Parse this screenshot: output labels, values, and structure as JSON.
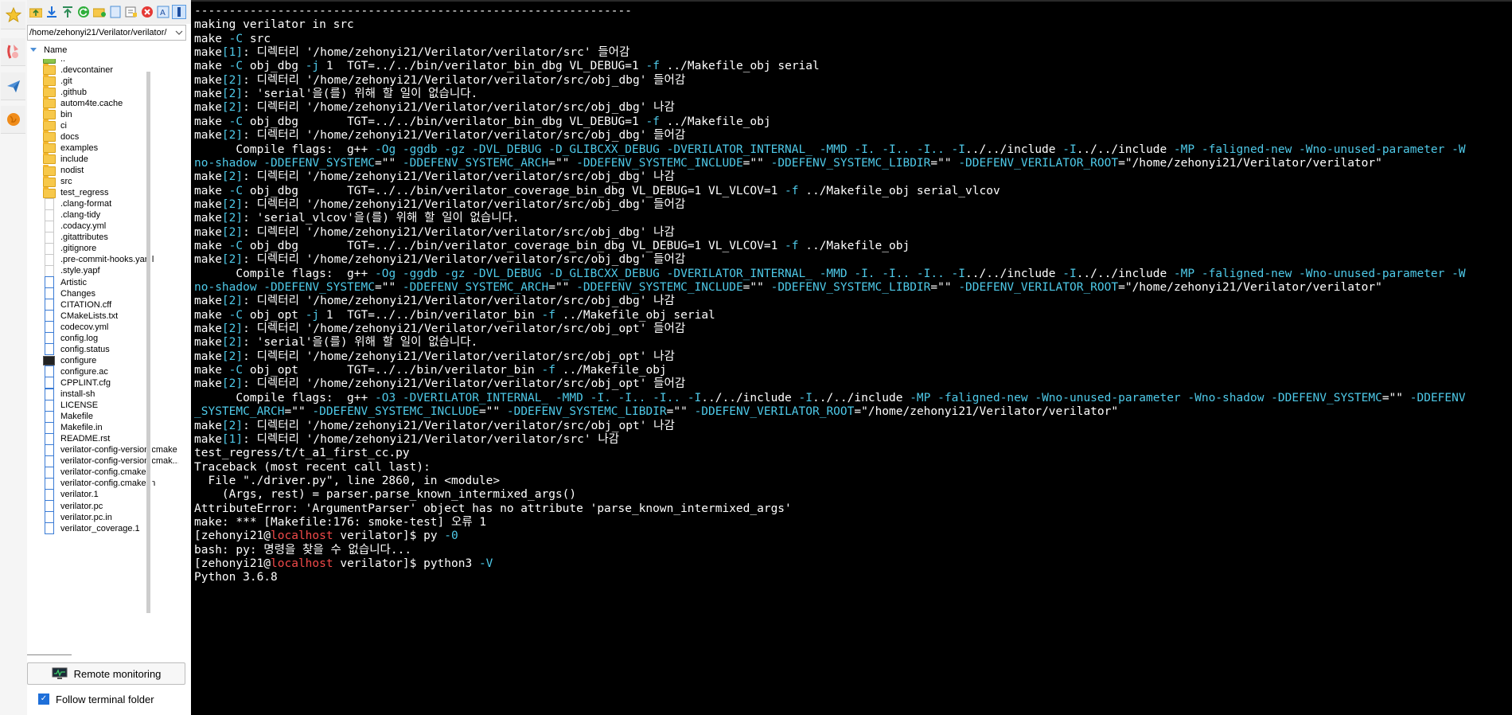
{
  "sidebar_strip": {
    "icons": [
      "star-icon",
      "sftp-icon",
      "send-icon",
      "globe-icon"
    ]
  },
  "file_browser": {
    "toolbar_icons": [
      "up-folder-icon",
      "download-icon",
      "upload-icon",
      "refresh-icon",
      "new-folder-icon",
      "new-file-icon",
      "delete-icon",
      "rename-icon",
      "properties-icon"
    ],
    "path": "/home/zehonyi21/Verilator/verilator/",
    "column_name": "Name",
    "items": [
      {
        "name": "..",
        "type": "up"
      },
      {
        "name": ".devcontainer",
        "type": "folder"
      },
      {
        "name": ".git",
        "type": "folder"
      },
      {
        "name": ".github",
        "type": "folder"
      },
      {
        "name": "autom4te.cache",
        "type": "folder"
      },
      {
        "name": "bin",
        "type": "folder"
      },
      {
        "name": "ci",
        "type": "folder"
      },
      {
        "name": "docs",
        "type": "folder"
      },
      {
        "name": "examples",
        "type": "folder"
      },
      {
        "name": "include",
        "type": "folder"
      },
      {
        "name": "nodist",
        "type": "folder"
      },
      {
        "name": "src",
        "type": "folder"
      },
      {
        "name": "test_regress",
        "type": "folder"
      },
      {
        "name": ".clang-format",
        "type": "blank"
      },
      {
        "name": ".clang-tidy",
        "type": "blank"
      },
      {
        "name": ".codacy.yml",
        "type": "blank"
      },
      {
        "name": ".gitattributes",
        "type": "blank"
      },
      {
        "name": ".gitignore",
        "type": "blank"
      },
      {
        "name": ".pre-commit-hooks.yaml",
        "type": "blank"
      },
      {
        "name": ".style.yapf",
        "type": "blank"
      },
      {
        "name": "Artistic",
        "type": "file"
      },
      {
        "name": "Changes",
        "type": "file"
      },
      {
        "name": "CITATION.cff",
        "type": "file"
      },
      {
        "name": "CMakeLists.txt",
        "type": "file"
      },
      {
        "name": "codecov.yml",
        "type": "file"
      },
      {
        "name": "config.log",
        "type": "file"
      },
      {
        "name": "config.status",
        "type": "file"
      },
      {
        "name": "configure",
        "type": "exe"
      },
      {
        "name": "configure.ac",
        "type": "file"
      },
      {
        "name": "CPPLINT.cfg",
        "type": "file"
      },
      {
        "name": "install-sh",
        "type": "file"
      },
      {
        "name": "LICENSE",
        "type": "file"
      },
      {
        "name": "Makefile",
        "type": "file"
      },
      {
        "name": "Makefile.in",
        "type": "file"
      },
      {
        "name": "README.rst",
        "type": "file"
      },
      {
        "name": "verilator-config-version.cmake",
        "type": "file"
      },
      {
        "name": "verilator-config-version.cmak...",
        "type": "file"
      },
      {
        "name": "verilator-config.cmake",
        "type": "file"
      },
      {
        "name": "verilator-config.cmake.in",
        "type": "file"
      },
      {
        "name": "verilator.1",
        "type": "file"
      },
      {
        "name": "verilator.pc",
        "type": "file"
      },
      {
        "name": "verilator.pc.in",
        "type": "file"
      },
      {
        "name": "verilator_coverage.1",
        "type": "file"
      }
    ],
    "remote_monitoring_label": "Remote monitoring",
    "follow_terminal_label": "Follow terminal folder",
    "follow_terminal_checked": true
  },
  "terminal": {
    "lines": [
      [
        {
          "t": "---------------------------------------------------------------"
        }
      ],
      [
        {
          "t": "making verilator in src"
        }
      ],
      [
        {
          "t": "make "
        },
        {
          "t": "-C",
          "c": "c"
        },
        {
          "t": " src"
        }
      ],
      [
        {
          "t": "make"
        },
        {
          "t": "[1]",
          "c": "c"
        },
        {
          "t": ": 디렉터리 '/home/zehonyi21/Verilator/verilator/src' 들어감"
        }
      ],
      [
        {
          "t": "make "
        },
        {
          "t": "-C",
          "c": "c"
        },
        {
          "t": " obj_dbg "
        },
        {
          "t": "-j",
          "c": "c"
        },
        {
          "t": " 1  TGT=../../bin/verilator_bin_dbg VL_DEBUG=1 "
        },
        {
          "t": "-f",
          "c": "c"
        },
        {
          "t": " ../Makefile_obj serial"
        }
      ],
      [
        {
          "t": "make"
        },
        {
          "t": "[2]",
          "c": "c"
        },
        {
          "t": ": 디렉터리 '/home/zehonyi21/Verilator/verilator/src/obj_dbg' 들어감"
        }
      ],
      [
        {
          "t": "make"
        },
        {
          "t": "[2]",
          "c": "c"
        },
        {
          "t": ": 'serial'을(를) 위해 할 일이 없습니다."
        }
      ],
      [
        {
          "t": "make"
        },
        {
          "t": "[2]",
          "c": "c"
        },
        {
          "t": ": 디렉터리 '/home/zehonyi21/Verilator/verilator/src/obj_dbg' 나감"
        }
      ],
      [
        {
          "t": "make "
        },
        {
          "t": "-C",
          "c": "c"
        },
        {
          "t": " obj_dbg       TGT=../../bin/verilator_bin_dbg VL_DEBUG=1 "
        },
        {
          "t": "-f",
          "c": "c"
        },
        {
          "t": " ../Makefile_obj"
        }
      ],
      [
        {
          "t": "make"
        },
        {
          "t": "[2]",
          "c": "c"
        },
        {
          "t": ": 디렉터리 '/home/zehonyi21/Verilator/verilator/src/obj_dbg' 들어감"
        }
      ],
      [
        {
          "t": "      Compile flags:  g++ "
        },
        {
          "t": "-Og -ggdb -gz -DVL_DEBUG -D_GLIBCXX_DEBUG -DVERILATOR_INTERNAL_ -MMD -I. -I.. -I.. -I",
          "c": "c"
        },
        {
          "t": "../../include "
        },
        {
          "t": "-I",
          "c": "c"
        },
        {
          "t": "../../include "
        },
        {
          "t": "-MP -faligned-new -Wno-unused-parameter -W",
          "c": "c"
        }
      ],
      [
        {
          "t": "no-shadow -DDEFENV_SYSTEMC",
          "c": "c"
        },
        {
          "t": "=\"\" "
        },
        {
          "t": "-DDEFENV_SYSTEMC_ARCH",
          "c": "c"
        },
        {
          "t": "=\"\" "
        },
        {
          "t": "-DDEFENV_SYSTEMC_INCLUDE",
          "c": "c"
        },
        {
          "t": "=\"\" "
        },
        {
          "t": "-DDEFENV_SYSTEMC_LIBDIR",
          "c": "c"
        },
        {
          "t": "=\"\" "
        },
        {
          "t": "-DDEFENV_VERILATOR_ROOT",
          "c": "c"
        },
        {
          "t": "=\"/home/zehonyi21/Verilator/verilator\""
        }
      ],
      [
        {
          "t": "make"
        },
        {
          "t": "[2]",
          "c": "c"
        },
        {
          "t": ": 디렉터리 '/home/zehonyi21/Verilator/verilator/src/obj_dbg' 나감"
        }
      ],
      [
        {
          "t": "make "
        },
        {
          "t": "-C",
          "c": "c"
        },
        {
          "t": " obj_dbg       TGT=../../bin/verilator_coverage_bin_dbg VL_DEBUG=1 VL_VLCOV=1 "
        },
        {
          "t": "-f",
          "c": "c"
        },
        {
          "t": " ../Makefile_obj serial_vlcov"
        }
      ],
      [
        {
          "t": "make"
        },
        {
          "t": "[2]",
          "c": "c"
        },
        {
          "t": ": 디렉터리 '/home/zehonyi21/Verilator/verilator/src/obj_dbg' 들어감"
        }
      ],
      [
        {
          "t": "make"
        },
        {
          "t": "[2]",
          "c": "c"
        },
        {
          "t": ": 'serial_vlcov'을(를) 위해 할 일이 없습니다."
        }
      ],
      [
        {
          "t": "make"
        },
        {
          "t": "[2]",
          "c": "c"
        },
        {
          "t": ": 디렉터리 '/home/zehonyi21/Verilator/verilator/src/obj_dbg' 나감"
        }
      ],
      [
        {
          "t": "make "
        },
        {
          "t": "-C",
          "c": "c"
        },
        {
          "t": " obj_dbg       TGT=../../bin/verilator_coverage_bin_dbg VL_DEBUG=1 VL_VLCOV=1 "
        },
        {
          "t": "-f",
          "c": "c"
        },
        {
          "t": " ../Makefile_obj"
        }
      ],
      [
        {
          "t": "make"
        },
        {
          "t": "[2]",
          "c": "c"
        },
        {
          "t": ": 디렉터리 '/home/zehonyi21/Verilator/verilator/src/obj_dbg' 들어감"
        }
      ],
      [
        {
          "t": "      Compile flags:  g++ "
        },
        {
          "t": "-Og -ggdb -gz -DVL_DEBUG -D_GLIBCXX_DEBUG -DVERILATOR_INTERNAL_ -MMD -I. -I.. -I.. -I",
          "c": "c"
        },
        {
          "t": "../../include "
        },
        {
          "t": "-I",
          "c": "c"
        },
        {
          "t": "../../include "
        },
        {
          "t": "-MP -faligned-new -Wno-unused-parameter -W",
          "c": "c"
        }
      ],
      [
        {
          "t": "no-shadow -DDEFENV_SYSTEMC",
          "c": "c"
        },
        {
          "t": "=\"\" "
        },
        {
          "t": "-DDEFENV_SYSTEMC_ARCH",
          "c": "c"
        },
        {
          "t": "=\"\" "
        },
        {
          "t": "-DDEFENV_SYSTEMC_INCLUDE",
          "c": "c"
        },
        {
          "t": "=\"\" "
        },
        {
          "t": "-DDEFENV_SYSTEMC_LIBDIR",
          "c": "c"
        },
        {
          "t": "=\"\" "
        },
        {
          "t": "-DDEFENV_VERILATOR_ROOT",
          "c": "c"
        },
        {
          "t": "=\"/home/zehonyi21/Verilator/verilator\""
        }
      ],
      [
        {
          "t": "make"
        },
        {
          "t": "[2]",
          "c": "c"
        },
        {
          "t": ": 디렉터리 '/home/zehonyi21/Verilator/verilator/src/obj_dbg' 나감"
        }
      ],
      [
        {
          "t": "make "
        },
        {
          "t": "-C",
          "c": "c"
        },
        {
          "t": " obj_opt "
        },
        {
          "t": "-j",
          "c": "c"
        },
        {
          "t": " 1  TGT=../../bin/verilator_bin "
        },
        {
          "t": "-f",
          "c": "c"
        },
        {
          "t": " ../Makefile_obj serial"
        }
      ],
      [
        {
          "t": "make"
        },
        {
          "t": "[2]",
          "c": "c"
        },
        {
          "t": ": 디렉터리 '/home/zehonyi21/Verilator/verilator/src/obj_opt' 들어감"
        }
      ],
      [
        {
          "t": "make"
        },
        {
          "t": "[2]",
          "c": "c"
        },
        {
          "t": ": 'serial'을(를) 위해 할 일이 없습니다."
        }
      ],
      [
        {
          "t": "make"
        },
        {
          "t": "[2]",
          "c": "c"
        },
        {
          "t": ": 디렉터리 '/home/zehonyi21/Verilator/verilator/src/obj_opt' 나감"
        }
      ],
      [
        {
          "t": "make "
        },
        {
          "t": "-C",
          "c": "c"
        },
        {
          "t": " obj_opt       TGT=../../bin/verilator_bin "
        },
        {
          "t": "-f",
          "c": "c"
        },
        {
          "t": " ../Makefile_obj"
        }
      ],
      [
        {
          "t": "make"
        },
        {
          "t": "[2]",
          "c": "c"
        },
        {
          "t": ": 디렉터리 '/home/zehonyi21/Verilator/verilator/src/obj_opt' 들어감"
        }
      ],
      [
        {
          "t": "      Compile flags:  g++ "
        },
        {
          "t": "-O3 -DVERILATOR_INTERNAL_ -MMD -I. -I.. -I.. -I",
          "c": "c"
        },
        {
          "t": "../../include "
        },
        {
          "t": "-I",
          "c": "c"
        },
        {
          "t": "../../include "
        },
        {
          "t": "-MP -faligned-new -Wno-unused-parameter -Wno-shadow -DDEFENV_SYSTEMC",
          "c": "c"
        },
        {
          "t": "=\"\" "
        },
        {
          "t": "-DDEFENV",
          "c": "c"
        }
      ],
      [
        {
          "t": "_SYSTEMC_ARCH",
          "c": "c"
        },
        {
          "t": "=\"\" "
        },
        {
          "t": "-DDEFENV_SYSTEMC_INCLUDE",
          "c": "c"
        },
        {
          "t": "=\"\" "
        },
        {
          "t": "-DDEFENV_SYSTEMC_LIBDIR",
          "c": "c"
        },
        {
          "t": "=\"\" "
        },
        {
          "t": "-DDEFENV_VERILATOR_ROOT",
          "c": "c"
        },
        {
          "t": "=\"/home/zehonyi21/Verilator/verilator\""
        }
      ],
      [
        {
          "t": "make"
        },
        {
          "t": "[2]",
          "c": "c"
        },
        {
          "t": ": 디렉터리 '/home/zehonyi21/Verilator/verilator/src/obj_opt' 나감"
        }
      ],
      [
        {
          "t": "make"
        },
        {
          "t": "[1]",
          "c": "c"
        },
        {
          "t": ": 디렉터리 '/home/zehonyi21/Verilator/verilator/src' 나감"
        }
      ],
      [
        {
          "t": "test_regress/t/t_a1_first_cc.py"
        }
      ],
      [
        {
          "t": "Traceback (most recent call last):"
        }
      ],
      [
        {
          "t": "  File \"./driver.py\", line 2860, in <module>"
        }
      ],
      [
        {
          "t": "    (Args, rest) = parser.parse_known_intermixed_args()"
        }
      ],
      [
        {
          "t": "AttributeError: 'ArgumentParser' object has no attribute 'parse_known_intermixed_args'"
        }
      ],
      [
        {
          "t": "make: *** [Makefile:176: smoke-test] 오류 1"
        }
      ],
      [
        {
          "t": "[zehonyi21@"
        },
        {
          "t": "localhost",
          "c": "r"
        },
        {
          "t": " verilator]$ py "
        },
        {
          "t": "-0",
          "c": "c"
        }
      ],
      [
        {
          "t": "bash: py: 명령을 찾을 수 없습니다..."
        }
      ],
      [
        {
          "t": "[zehonyi21@"
        },
        {
          "t": "localhost",
          "c": "r"
        },
        {
          "t": " verilator]$ python3 "
        },
        {
          "t": "-V",
          "c": "c"
        }
      ],
      [
        {
          "t": "Python 3.6.8"
        }
      ]
    ]
  },
  "colors": {
    "terminal_bg": "#000000",
    "terminal_fg": "#ffffff",
    "flag_color": "#4ec9e8",
    "host_color": "#f24a4a",
    "folder": "#f7c84a",
    "accent": "#1e6fd9"
  }
}
